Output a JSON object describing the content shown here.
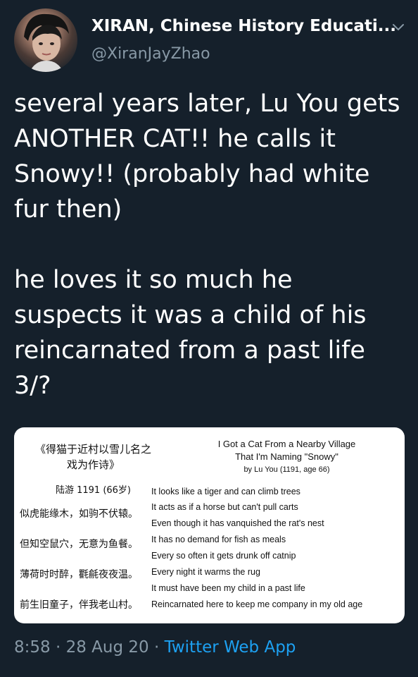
{
  "author": {
    "display_name": "XIRAN, Chinese History Educati...",
    "handle": "@XiranJayZhao",
    "avatar_icon": "profile-avatar"
  },
  "tweet": {
    "text": "several years later, Lu You gets ANOTHER CAT!! he calls it Snowy!! (probably had white fur then)\n\nhe loves it so much he suspects it was a child of his reincarnated from a past life 3/?"
  },
  "media": {
    "chinese_title": "《得猫于近村以雪儿名之\n戏为作诗》",
    "chinese_author": "陆游 1191 (66岁)",
    "chinese_lines": [
      "似虎能缘木，如驹不伏辕。",
      "但知空鼠穴，无意为鱼餐。",
      "薄荷时时醉，氍毹夜夜温。",
      "前生旧童子，伴我老山村。"
    ],
    "english_title": "I Got a Cat From a Nearby Village\nThat I'm Naming \"Snowy\"",
    "english_author": "by Lu You (1191, age 66)",
    "english_lines": [
      "It looks like a tiger and can climb trees",
      "It acts as if a horse but can't pull carts",
      "Even though it has vanquished the rat's nest",
      "It has no demand for fish as meals",
      "Every so often it gets drunk off catnip",
      "Every night it warms the rug",
      "It must have been my child in a past life",
      "Reincarnated here to keep me company in my old age"
    ]
  },
  "footer": {
    "time": "8:58",
    "sep1": " · ",
    "date": "28 Aug 20",
    "sep2": " · ",
    "app": "Twitter Web App"
  },
  "colors": {
    "background": "#15202b",
    "text": "#ffffff",
    "secondary": "#8899a6",
    "link": "#1da1f2"
  }
}
